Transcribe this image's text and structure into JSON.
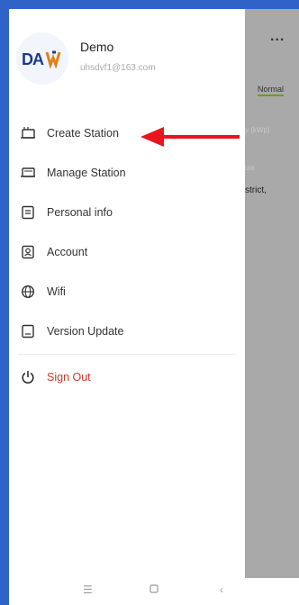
{
  "user": {
    "name": "Demo",
    "email": "uhsdvf1@163.com",
    "logo_text": "DAH"
  },
  "menu": {
    "items": [
      {
        "label": "Create Station",
        "icon": "create-station-icon"
      },
      {
        "label": "Manage Station",
        "icon": "manage-station-icon"
      },
      {
        "label": "Personal info",
        "icon": "personal-info-icon"
      },
      {
        "label": "Account",
        "icon": "account-icon"
      },
      {
        "label": "Wifi",
        "icon": "wifi-globe-icon"
      },
      {
        "label": "Version Update",
        "icon": "version-update-icon"
      }
    ],
    "signout": {
      "label": "Sign Out",
      "icon": "power-icon"
    }
  },
  "background": {
    "menu_dots": "...",
    "status": "Normal",
    "text1": "y (kWp)",
    "text2": "ute",
    "text3": "strict,"
  },
  "colors": {
    "frame": "#2f63c9",
    "signout": "#d23a2a",
    "arrow": "#e8141e",
    "status_underline": "#6aa000"
  }
}
